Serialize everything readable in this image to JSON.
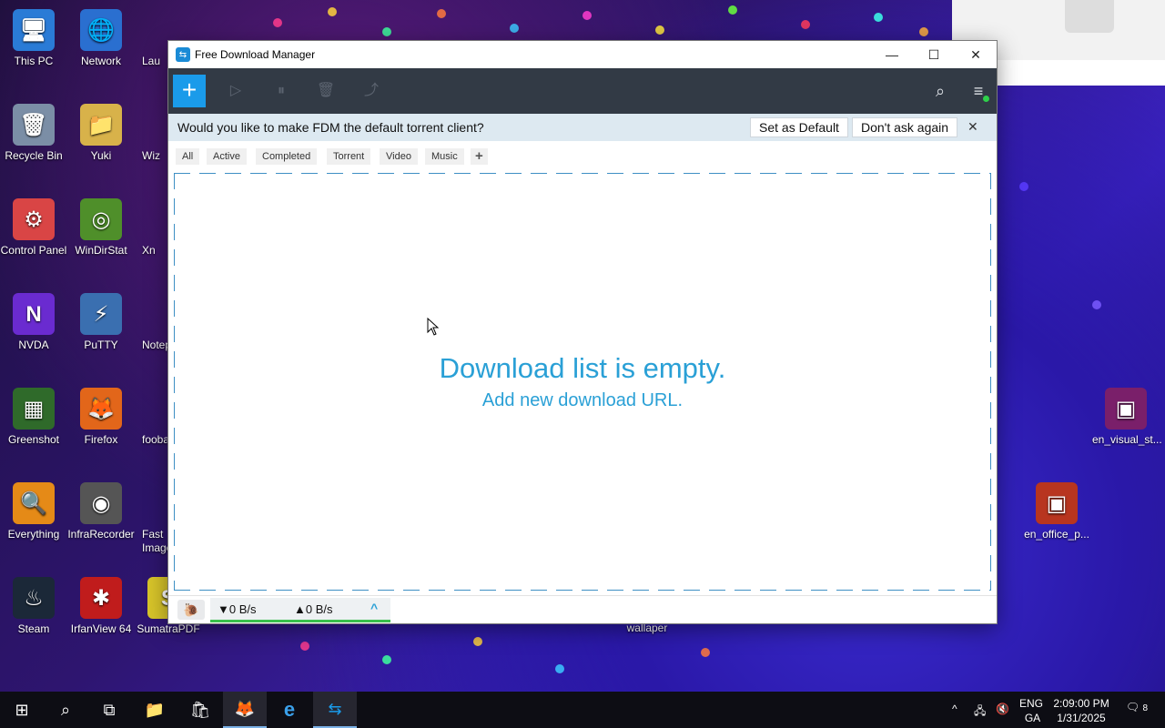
{
  "desktop": {
    "icons": [
      {
        "label": "This PC",
        "glyph": "🖥",
        "color": "#2a7bd6"
      },
      {
        "label": "Network",
        "glyph": "🌐",
        "color": "#2a6fd0"
      },
      {
        "label": "Recycle Bin",
        "glyph": "🗑",
        "color": "#7b8ea6"
      },
      {
        "label": "Yuki",
        "glyph": "📁",
        "color": "#d8b24a"
      },
      {
        "label": "Control Panel",
        "glyph": "⚙",
        "color": "#d94545"
      },
      {
        "label": "WinDirStat",
        "glyph": "◎",
        "color": "#4f8f2a"
      },
      {
        "label": "NVDA",
        "glyph": "N",
        "color": "#6a2bd0"
      },
      {
        "label": "PuTTY",
        "glyph": "⚡",
        "color": "#3a6fb0"
      },
      {
        "label": "Greenshot",
        "glyph": "▦",
        "color": "#2f6a2a"
      },
      {
        "label": "Firefox",
        "glyph": "🦊",
        "color": "#e2661a"
      },
      {
        "label": "Everything",
        "glyph": "🔍",
        "color": "#e58a17"
      },
      {
        "label": "InfraRecorder",
        "glyph": "◉",
        "color": "#555555"
      },
      {
        "label": "Steam",
        "glyph": "♨",
        "color": "#1b2838"
      },
      {
        "label": "IrfanView 64",
        "glyph": "✱",
        "color": "#c01c1c"
      },
      {
        "label": "SumatraPDF",
        "glyph": "S",
        "color": "#d8c52a"
      },
      {
        "label": "wallaper",
        "glyph": "",
        "color": "transparent"
      },
      {
        "label": "en_visual_st...",
        "glyph": "▣",
        "color": "#7a1f6a"
      },
      {
        "label": "en_office_p...",
        "glyph": "▣",
        "color": "#b8351f"
      }
    ],
    "partial_labels": [
      "Lau",
      "Wiz",
      "Xn",
      "Notep",
      "fooba",
      "Fast Image"
    ]
  },
  "window": {
    "title": "Free Download Manager",
    "minimize": "—",
    "maximize": "☐",
    "close": "✕"
  },
  "toolbar": {
    "add": "+",
    "resume_icon": "▷",
    "pause_icon": "⏸",
    "delete_icon": "🗑",
    "move_icon": "⤴",
    "search_icon": "⌕",
    "menu_icon": "≡"
  },
  "banner": {
    "message": "Would you like to make FDM the default torrent client?",
    "set_default": "Set as Default",
    "dont_ask": "Don't ask again",
    "close": "✕"
  },
  "tabs": [
    {
      "label": "All"
    },
    {
      "label": "Active"
    },
    {
      "label": "Completed"
    },
    {
      "label": "Torrent"
    },
    {
      "label": "Video"
    },
    {
      "label": "Music"
    },
    {
      "label": "+"
    }
  ],
  "empty_state": {
    "title": "Download list is empty.",
    "subtitle": "Add new download URL."
  },
  "status": {
    "snail": "🐌",
    "download_speed": "▼0 B/s",
    "upload_speed": "▲0 B/s",
    "expand": "^"
  },
  "taskbar": {
    "start": "⊞",
    "search": "⌕",
    "taskview": "⧉",
    "explorer": "📁",
    "store": "🛍",
    "firefox": "🦊",
    "edge": "e",
    "fdm": "⇆",
    "tray_chevron": "^",
    "network": "🖧",
    "volume": "🔇",
    "lang_top": "ENG",
    "lang_bottom": "GA",
    "time": "2:09:00 PM",
    "date": "1/31/2025",
    "notifications": "8"
  },
  "colors": {
    "accent": "#1a9bea",
    "toolbar_bg": "#323a45",
    "banner_bg": "#dde9f1",
    "empty_text": "#2aa0d6",
    "speed_bar": "#39c04c"
  }
}
